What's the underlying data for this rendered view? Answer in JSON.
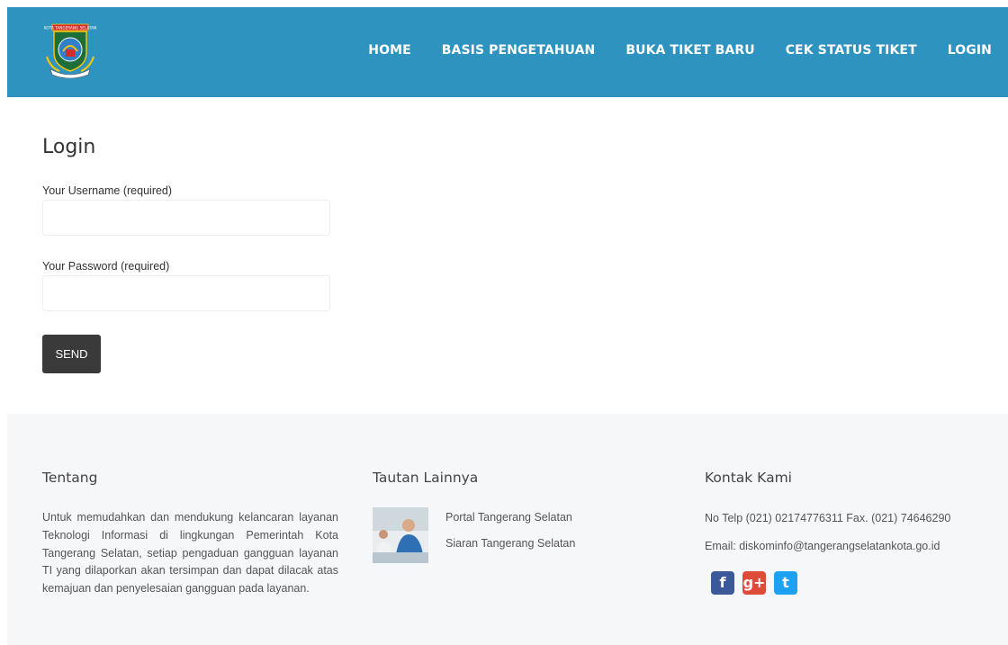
{
  "nav": {
    "items": [
      {
        "label": "HOME"
      },
      {
        "label": "BASIS PENGETAHUAN"
      },
      {
        "label": "BUKA TIKET BARU"
      },
      {
        "label": "CEK STATUS TIKET"
      },
      {
        "label": "LOGIN"
      }
    ],
    "bar_color": "#2e93bf"
  },
  "logo": {
    "icon": "city-emblem-icon",
    "banner_text": "KOTA TANGERANG SELATAN"
  },
  "login": {
    "title": "Login",
    "username_label": "Your Username (required)",
    "username_value": "",
    "password_label": "Your Password (required)",
    "password_value": "",
    "send_label": "SEND"
  },
  "footer": {
    "about": {
      "heading": "Tentang",
      "text": "Untuk memudahkan dan mendukung kelancaran layanan Teknologi Informasi di lingkungan Pemerintah Kota Tangerang Selatan, setiap pengaduan gangguan layanan TI yang dilaporkan akan tersimpan dan dapat dilacak atas kemajuan dan penyelesaian gangguan pada layanan."
    },
    "links": {
      "heading": "Tautan Lainnya",
      "items": [
        {
          "label": "Portal Tangerang Selatan"
        },
        {
          "label": "Siaran Tangerang Selatan"
        }
      ]
    },
    "contact": {
      "heading": "Kontak Kami",
      "phone": "No Telp (021) 02174776311 Fax. (021) 74646290",
      "email": "Email: diskominfo@tangerangselatankota.go.id",
      "social": [
        {
          "icon": "facebook-icon",
          "glyph": "f",
          "color": "#3b5998"
        },
        {
          "icon": "google-plus-icon",
          "glyph": "g+",
          "color": "#dd4b39"
        },
        {
          "icon": "twitter-icon",
          "glyph": "t",
          "color": "#1da1f2"
        }
      ]
    }
  }
}
